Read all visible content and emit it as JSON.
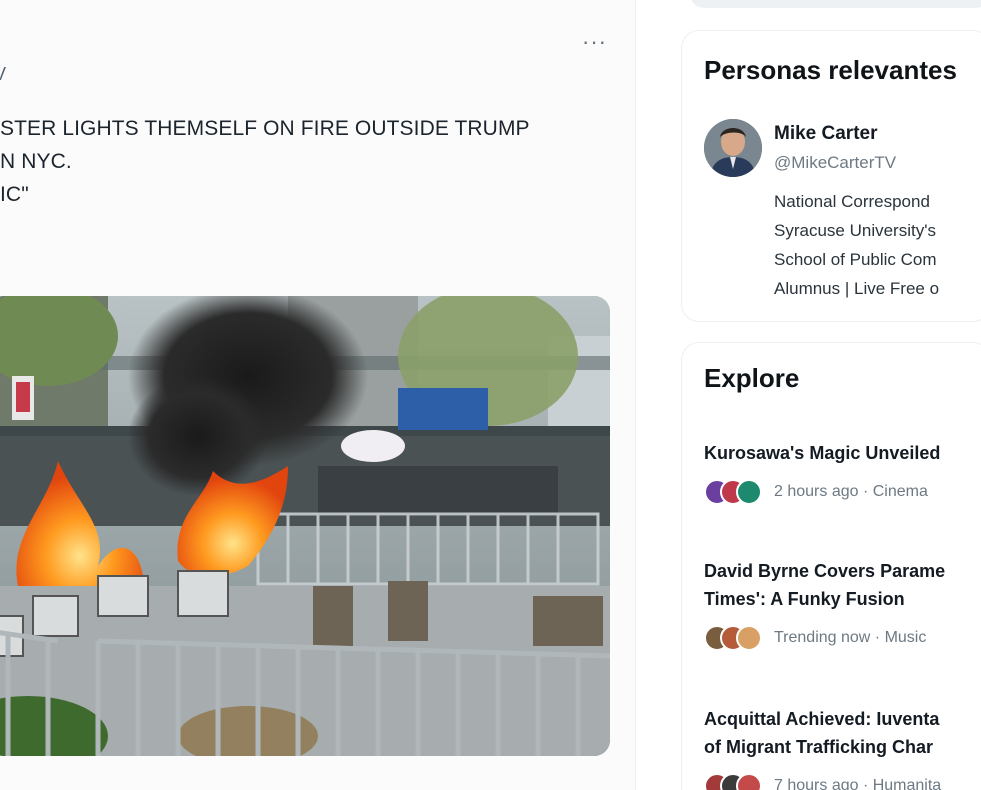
{
  "tweet": {
    "more_label": "···",
    "handle_fragment": "V",
    "text_lines": [
      "STER LIGHTS THEMSELF ON FIRE OUTSIDE TRUMP",
      "N NYC."
    ],
    "text_trailing": "IC\"",
    "image_alt": "Fire burning near chairs and metal barricades outside a courthouse park"
  },
  "sidebar": {
    "relevant_people": {
      "title": "Personas relevantes",
      "person": {
        "name": "Mike Carter",
        "handle": "@MikeCarterTV",
        "bio_lines": [
          "National Correspond",
          "Syracuse University's",
          "School of Public Com",
          "Alumnus | Live Free o"
        ]
      }
    },
    "explore": {
      "title": "Explore",
      "trends": [
        {
          "title_lines": [
            "Kurosawa's Magic Unveiled"
          ],
          "meta": "2 hours ago · Cinema",
          "face_colors": [
            "#6b3fa0",
            "#c0394b",
            "#1d8a6f"
          ]
        },
        {
          "title_lines": [
            "David Byrne Covers Parame",
            "Times': A Funky Fusion"
          ],
          "meta": "Trending now · Music",
          "face_colors": [
            "#7a5c3e",
            "#b55b3a",
            "#d9a066"
          ]
        },
        {
          "title_lines": [
            "Acquittal Achieved: Iuventa",
            "of Migrant Trafficking Char"
          ],
          "meta": "7 hours ago · Humanita",
          "face_colors": [
            "#a33a3a",
            "#3b3b3b",
            "#c44a4a"
          ]
        }
      ]
    }
  },
  "colors": {
    "text_primary": "#0f1419",
    "text_secondary": "#6d7983",
    "border": "#eceff1"
  }
}
